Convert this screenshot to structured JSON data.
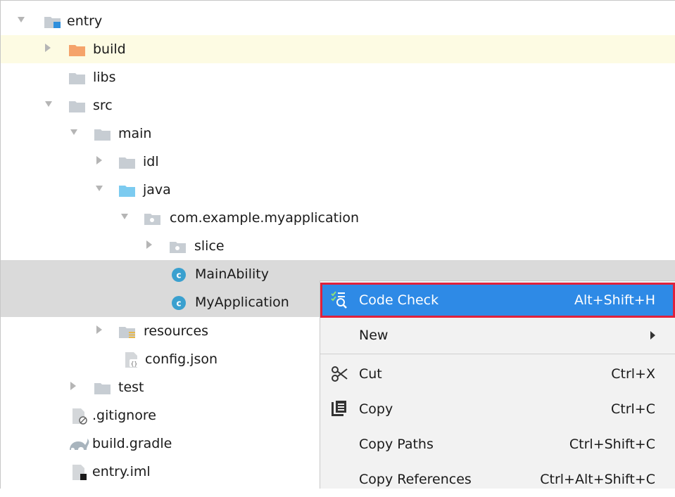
{
  "tree": {
    "items": [
      {
        "label": "entry",
        "icon": "module-folder-icon"
      },
      {
        "label": "build",
        "icon": "build-folder-icon"
      },
      {
        "label": "libs",
        "icon": "folder-icon"
      },
      {
        "label": "src",
        "icon": "folder-icon"
      },
      {
        "label": "main",
        "icon": "folder-icon"
      },
      {
        "label": "idl",
        "icon": "folder-icon"
      },
      {
        "label": "java",
        "icon": "source-folder-icon"
      },
      {
        "label": "com.example.myapplication",
        "icon": "package-icon"
      },
      {
        "label": "slice",
        "icon": "package-icon"
      },
      {
        "label": "MainAbility",
        "icon": "class-icon"
      },
      {
        "label": "MyApplication",
        "icon": "class-icon"
      },
      {
        "label": "resources",
        "icon": "resources-folder-icon"
      },
      {
        "label": "config.json",
        "icon": "json-file-icon"
      },
      {
        "label": "test",
        "icon": "folder-icon"
      },
      {
        "label": ".gitignore",
        "icon": "ignored-file-icon"
      },
      {
        "label": "build.gradle",
        "icon": "gradle-icon"
      },
      {
        "label": "entry.iml",
        "icon": "iml-file-icon"
      }
    ]
  },
  "context_menu": {
    "items": [
      {
        "label": "Code Check",
        "shortcut": "Alt+Shift+H",
        "icon": "code-check-icon"
      },
      {
        "label": "New",
        "shortcut": "",
        "icon": "chevron-right-icon"
      },
      {
        "label": "Cut",
        "shortcut": "Ctrl+X",
        "icon": "scissors-icon"
      },
      {
        "label": "Copy",
        "shortcut": "Ctrl+C",
        "icon": "copy-icon"
      },
      {
        "label": "Copy Paths",
        "shortcut": "Ctrl+Shift+C",
        "icon": ""
      },
      {
        "label": "Copy References",
        "shortcut": "Ctrl+Alt+Shift+C",
        "icon": ""
      }
    ]
  },
  "colors": {
    "menu_highlight": "#2e8ae6",
    "menu_highlight_border": "#e0213b",
    "build_row_bg": "#fdfbe3",
    "selected_row_bg": "#dadada",
    "folder_grey": "#c7cdd3",
    "folder_orange": "#f5a36b",
    "folder_blue": "#7ccbf0"
  }
}
